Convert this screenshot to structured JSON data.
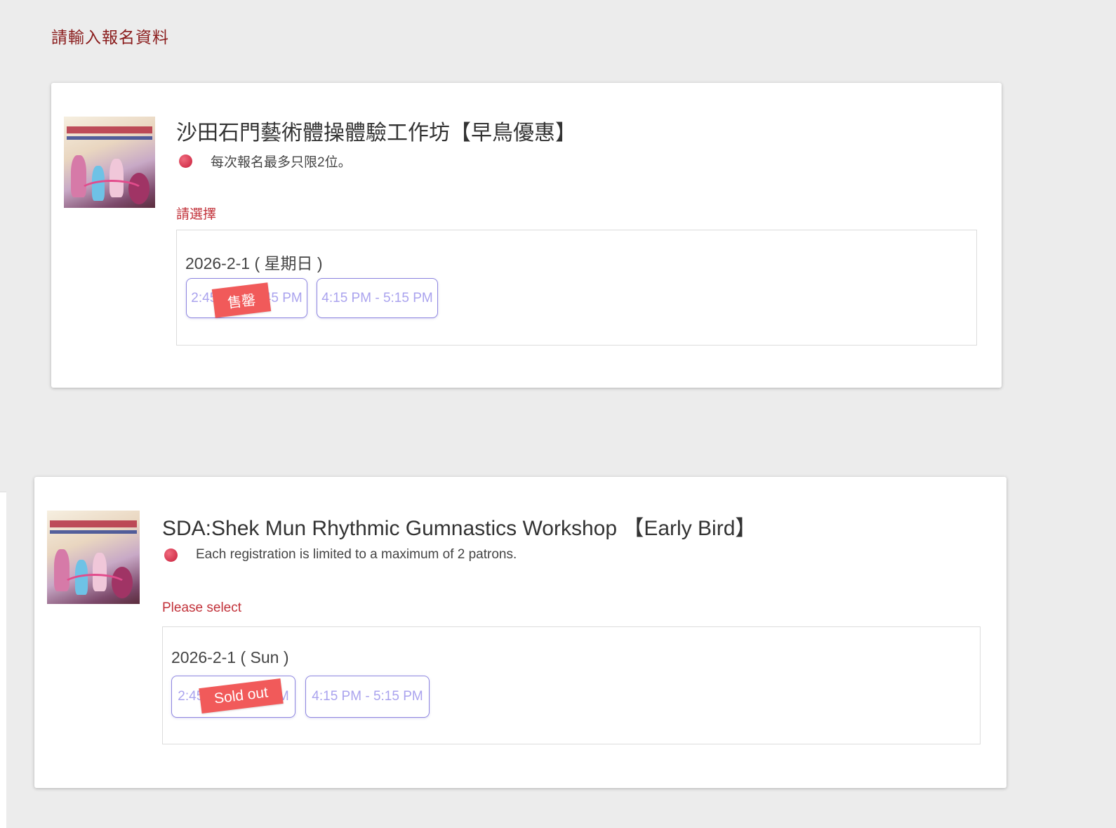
{
  "page": {
    "heading": "請輸入報名資料"
  },
  "events": [
    {
      "title": "沙田石門藝術體操體驗工作坊【早鳥優惠】",
      "note": "每次報名最多只限2位。",
      "select_label": "請選擇",
      "date": "2026-2-1 ( 星期日 )",
      "slots": [
        {
          "label": "2:45 PM - 3:45 PM",
          "status": "售罄"
        },
        {
          "label": "4:15 PM - 5:15 PM"
        }
      ]
    },
    {
      "title": "SDA:Shek Mun Rhythmic Gumnastics Workshop 【Early Bird】",
      "note": "Each registration is limited to a maximum of 2 patrons.",
      "select_label": "Please select",
      "date": "2026-2-1 ( Sun )",
      "slots": [
        {
          "label": "2:45 PM - 3:45 PM",
          "status": "Sold out"
        },
        {
          "label": "4:15 PM - 5:15 PM"
        }
      ]
    }
  ],
  "icons": {
    "note_bullet": "red-dot-icon",
    "event_thumbnail": "event-poster-thumbnail"
  },
  "colors": {
    "heading": "#8a1c1c",
    "select_label": "#c2323a",
    "slot_border": "#8e86e0",
    "slot_text": "#aaa3ee",
    "soldout_badge": "#f15a5a"
  }
}
